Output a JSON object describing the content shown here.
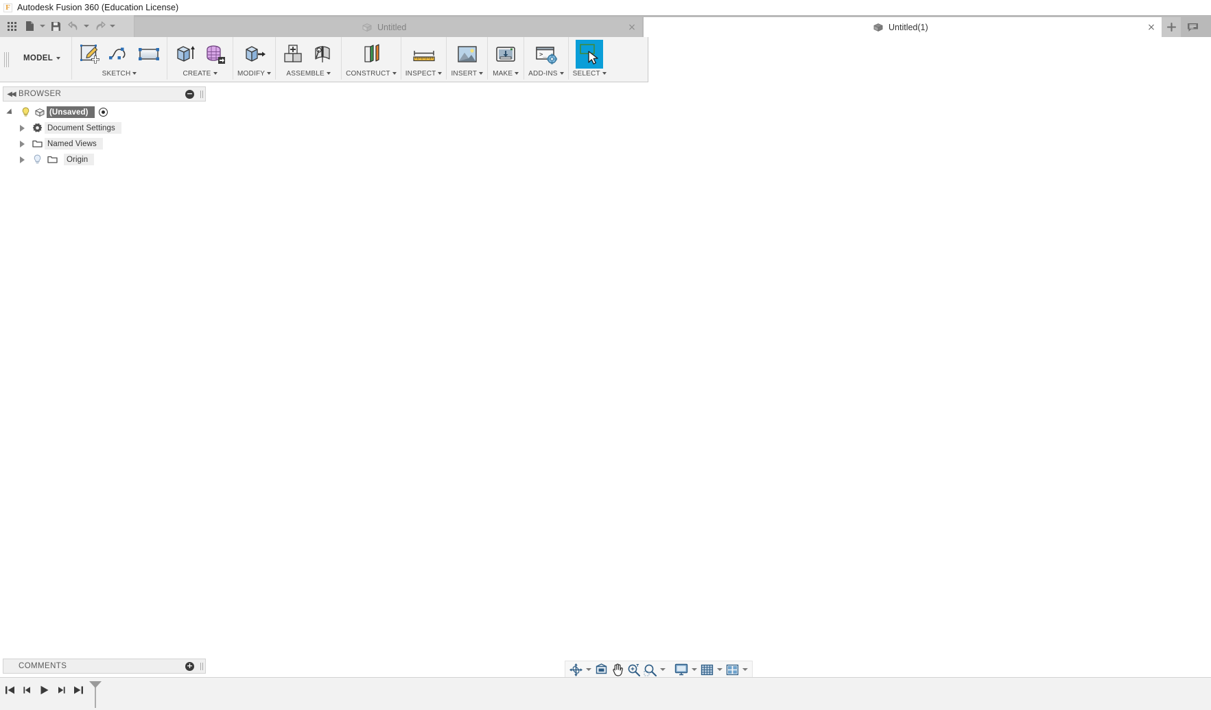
{
  "window": {
    "app_title": "Autodesk Fusion 360 (Education License)",
    "logo_letter": "F"
  },
  "quick_access": {
    "items": [
      {
        "name": "app-grid-icon",
        "label": "Show Data Panel"
      },
      {
        "name": "new-document-icon",
        "label": "File"
      },
      {
        "name": "save-icon",
        "label": "Save"
      },
      {
        "name": "undo-icon",
        "label": "Undo"
      },
      {
        "name": "redo-icon",
        "label": "Redo"
      }
    ]
  },
  "tabs": {
    "items": [
      {
        "label": "Untitled",
        "active": false,
        "close_glyph": "×"
      },
      {
        "label": "Untitled(1)",
        "active": true,
        "close_glyph": "×"
      }
    ],
    "new_tab_glyph": "+",
    "new_tab_name": "new-tab-button",
    "comment_button_name": "comments-toggle-button"
  },
  "ribbon": {
    "workspace": {
      "label": "MODEL"
    },
    "panels": [
      {
        "label": "SKETCH",
        "commands": [
          {
            "name": "create-sketch-icon",
            "label": "Create Sketch"
          },
          {
            "name": "spline-icon",
            "label": "Spline"
          },
          {
            "name": "rectangle-icon",
            "label": "Rectangle"
          }
        ]
      },
      {
        "label": "CREATE",
        "commands": [
          {
            "name": "extrude-icon",
            "label": "Extrude"
          },
          {
            "name": "create-form-icon",
            "label": "Create Form"
          }
        ]
      },
      {
        "label": "MODIFY",
        "commands": [
          {
            "name": "press-pull-icon",
            "label": "Press Pull"
          }
        ]
      },
      {
        "label": "ASSEMBLE",
        "commands": [
          {
            "name": "new-component-icon",
            "label": "New Component"
          },
          {
            "name": "joint-icon",
            "label": "Joint"
          }
        ]
      },
      {
        "label": "CONSTRUCT",
        "commands": [
          {
            "name": "offset-plane-icon",
            "label": "Offset Plane"
          }
        ]
      },
      {
        "label": "INSPECT",
        "commands": [
          {
            "name": "measure-icon",
            "label": "Measure"
          }
        ]
      },
      {
        "label": "INSERT",
        "commands": [
          {
            "name": "insert-mcmaster-icon",
            "label": "Insert McMaster-Carr Component"
          }
        ]
      },
      {
        "label": "MAKE",
        "commands": [
          {
            "name": "3d-print-icon",
            "label": "3D Print"
          }
        ]
      },
      {
        "label": "ADD-INS",
        "commands": [
          {
            "name": "scripts-addins-icon",
            "label": "Scripts and Add-Ins"
          }
        ]
      },
      {
        "label": "SELECT",
        "selected": true,
        "commands": [
          {
            "name": "select-tool-icon",
            "label": "Select"
          }
        ]
      }
    ]
  },
  "browser": {
    "title": "BROWSER",
    "collapse_glyph": "◀◀",
    "header_button": {
      "name": "browser-collapse-button",
      "glyph": "−"
    },
    "tree": [
      {
        "label": "(Unsaved)",
        "name": "browser-root-node",
        "selected": true,
        "indent": 0,
        "expander": "open",
        "bulb": true,
        "icon": "component-icon",
        "radio": true
      },
      {
        "label": "Document Settings",
        "name": "browser-node-document-settings",
        "selected": false,
        "indent": 1,
        "expander": "closed",
        "bulb": false,
        "icon": "gear-icon",
        "radio": false
      },
      {
        "label": "Named Views",
        "name": "browser-node-named-views",
        "selected": false,
        "indent": 1,
        "expander": "closed",
        "bulb": false,
        "icon": "folder-icon",
        "radio": false
      },
      {
        "label": "Origin",
        "name": "browser-node-origin",
        "selected": false,
        "indent": 1,
        "expander": "closed",
        "bulb": true,
        "icon": "folder-icon",
        "radio": false
      }
    ]
  },
  "comments": {
    "title": "COMMENTS",
    "header_button": {
      "name": "add-comment-button",
      "glyph": "+"
    }
  },
  "navbar": {
    "items": [
      {
        "name": "orbit-icon",
        "label": "Orbit",
        "caret": true
      },
      {
        "name": "look-at-icon",
        "label": "Look At",
        "caret": false
      },
      {
        "name": "pan-icon",
        "label": "Pan",
        "caret": false
      },
      {
        "name": "zoom-icon",
        "label": "Zoom",
        "caret": false
      },
      {
        "name": "zoom-window-icon",
        "label": "Fit",
        "caret": true
      },
      {
        "name": "display-settings-icon",
        "label": "Display Settings",
        "caret": true
      },
      {
        "name": "grid-snaps-icon",
        "label": "Grid and Snaps",
        "caret": true
      },
      {
        "name": "viewports-icon",
        "label": "Viewports",
        "caret": true
      }
    ]
  },
  "timeline": {
    "controls": [
      {
        "name": "go-to-beginning-button",
        "label": "Go to Beginning"
      },
      {
        "name": "step-back-button",
        "label": "Step Back"
      },
      {
        "name": "play-button",
        "label": "Play"
      },
      {
        "name": "step-forward-button",
        "label": "Step Forward"
      },
      {
        "name": "go-to-end-button",
        "label": "Go to End"
      }
    ],
    "marker_name": "timeline-marker"
  },
  "colors": {
    "accent_select": "#0a9ed8",
    "titlebar_bg": "#ffffff",
    "tabstrip_bg": "#b9b9b9",
    "ribbon_bg": "#f3f3f3",
    "viewport_bg": "#ffffff",
    "selection_chip": "#6e6e6e"
  }
}
